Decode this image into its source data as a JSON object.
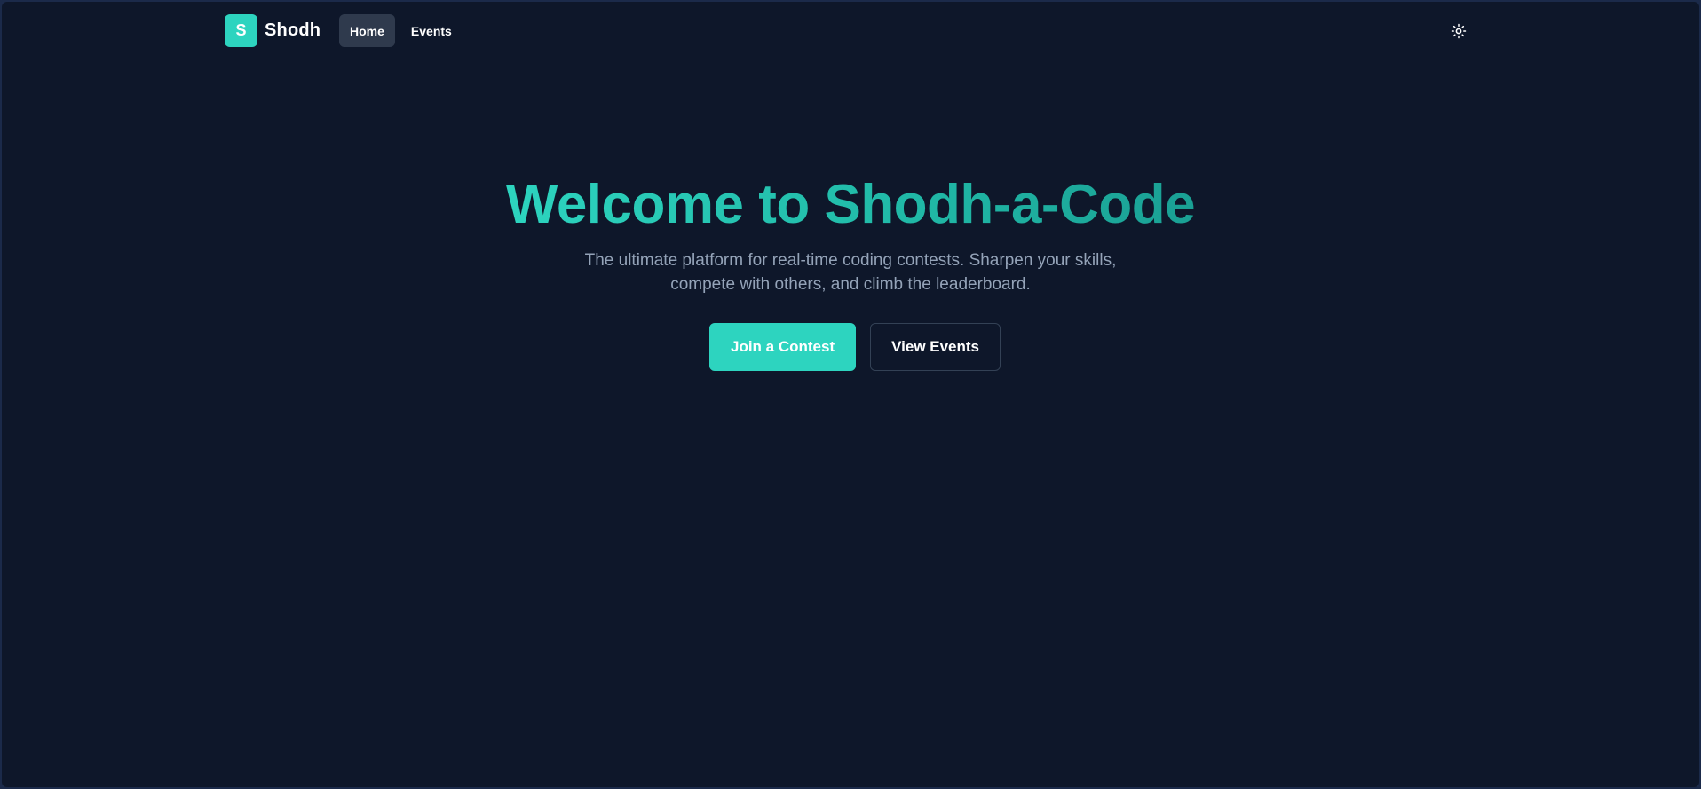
{
  "brand": {
    "logo_letter": "S",
    "name": "Shodh"
  },
  "nav": {
    "items": [
      {
        "label": "Home",
        "active": true
      },
      {
        "label": "Events",
        "active": false
      }
    ]
  },
  "theme_toggle": {
    "icon": "sun-icon"
  },
  "hero": {
    "title": "Welcome to Shodh-a-Code",
    "subtitle": "The ultimate platform for real-time coding contests. Sharpen your skills, compete with others, and climb the leaderboard.",
    "primary_button": "Join a Contest",
    "secondary_button": "View Events"
  },
  "colors": {
    "background": "#0e172a",
    "accent": "#2dd4bf",
    "muted_text": "#94a3b8",
    "nav_active": "#2f3a4d"
  }
}
